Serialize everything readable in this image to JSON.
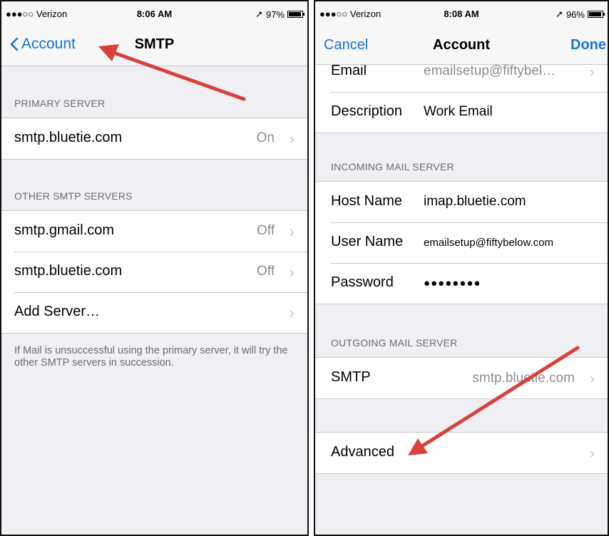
{
  "left": {
    "status": {
      "carrier": "●●●○○ Verizon",
      "time": "8:06 AM",
      "battery": "97%"
    },
    "nav": {
      "back_label": "Account",
      "title": "SMTP"
    },
    "primary_header": "PRIMARY SERVER",
    "primary": [
      {
        "label": "smtp.bluetie.com",
        "value": "On"
      }
    ],
    "other_header": "OTHER SMTP SERVERS",
    "other": [
      {
        "label": "smtp.gmail.com",
        "value": "Off"
      },
      {
        "label": "smtp.bluetie.com",
        "value": "Off"
      },
      {
        "label": "Add Server…",
        "value": ""
      }
    ],
    "footer": "If Mail is unsuccessful using the primary server, it will try the other SMTP servers in succession."
  },
  "right": {
    "status": {
      "carrier": "●●●○○ Verizon",
      "time": "8:08 AM",
      "battery": "96%"
    },
    "nav": {
      "cancel": "Cancel",
      "title": "Account",
      "done": "Done"
    },
    "top_rows": [
      {
        "label": "Email",
        "value": "emailsetup@fiftybel…"
      },
      {
        "label": "Description",
        "value": "Work Email"
      }
    ],
    "incoming_header": "INCOMING MAIL SERVER",
    "incoming": [
      {
        "label": "Host Name",
        "value": "imap.bluetie.com"
      },
      {
        "label": "User Name",
        "value": "emailsetup@fiftybelow.com"
      },
      {
        "label": "Password",
        "value": "●●●●●●●●"
      }
    ],
    "outgoing_header": "OUTGOING MAIL SERVER",
    "outgoing": [
      {
        "label": "SMTP",
        "value": "smtp.bluetie.com"
      }
    ],
    "advanced": {
      "label": "Advanced"
    }
  },
  "colors": {
    "accent": "#1474d4",
    "annotation_arrow": "#d9403a",
    "background": "#efeff4"
  }
}
